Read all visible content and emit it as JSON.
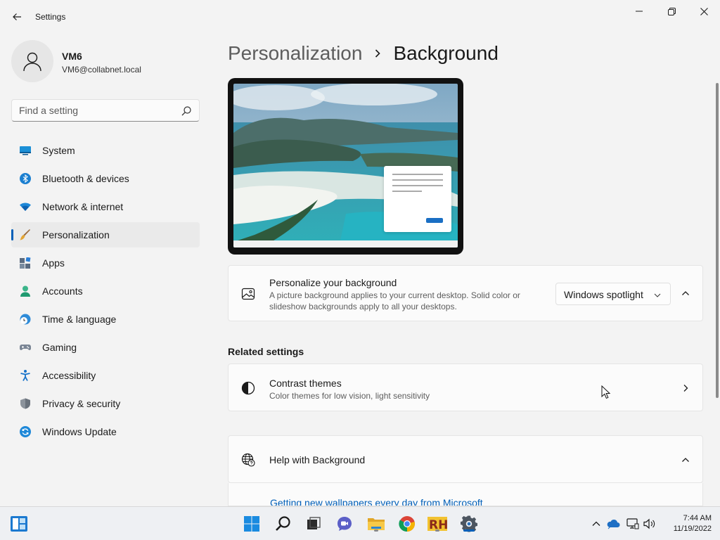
{
  "window": {
    "app_title": "Settings"
  },
  "user": {
    "name": "VM6",
    "email": "VM6@collabnet.local"
  },
  "search": {
    "placeholder": "Find a setting"
  },
  "sidebar": {
    "items": [
      {
        "label": "System",
        "icon": "system-icon"
      },
      {
        "label": "Bluetooth & devices",
        "icon": "bluetooth-icon"
      },
      {
        "label": "Network & internet",
        "icon": "wifi-icon"
      },
      {
        "label": "Personalization",
        "icon": "brush-icon",
        "active": true
      },
      {
        "label": "Apps",
        "icon": "apps-icon"
      },
      {
        "label": "Accounts",
        "icon": "accounts-icon"
      },
      {
        "label": "Time & language",
        "icon": "globe-clock-icon"
      },
      {
        "label": "Gaming",
        "icon": "gamepad-icon"
      },
      {
        "label": "Accessibility",
        "icon": "accessibility-icon"
      },
      {
        "label": "Privacy & security",
        "icon": "shield-icon"
      },
      {
        "label": "Windows Update",
        "icon": "update-icon"
      }
    ]
  },
  "header": {
    "parent": "Personalization",
    "current": "Background"
  },
  "background_card": {
    "title": "Personalize your background",
    "description_line1": "A picture background applies to your current desktop. Solid color or",
    "description_line2": "slideshow backgrounds apply to all your desktops.",
    "selected_option": "Windows spotlight"
  },
  "related": {
    "section_title": "Related settings",
    "contrast_title": "Contrast themes",
    "contrast_description": "Color themes for low vision, light sensitivity"
  },
  "help": {
    "title": "Help with Background",
    "link": "Getting new wallpapers every day from Microsoft"
  },
  "taskbar": {
    "time": "7:44 AM",
    "date": "11/19/2022",
    "apps": [
      "start-icon",
      "search-icon",
      "task-view-icon",
      "chat-icon",
      "file-explorer-icon",
      "chrome-icon",
      "rh-app-icon",
      "settings-icon"
    ]
  },
  "colors": {
    "accent": "#005fb8",
    "background": "#f3f3f3",
    "card": "#fbfbfb"
  }
}
